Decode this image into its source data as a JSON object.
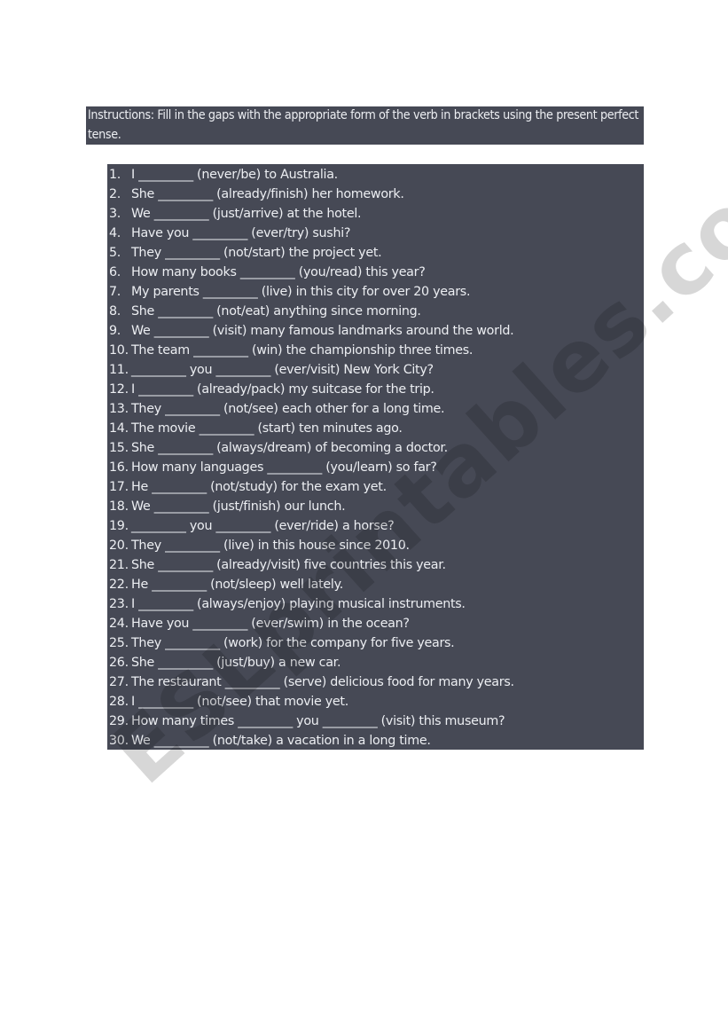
{
  "instructions": "Instructions: Fill in the gaps with the appropriate form of the verb in brackets using the present perfect tense.",
  "watermark": "ESLprintables.com",
  "colors": {
    "box_background": "#464955",
    "text": "#eceef2",
    "page_background": "#ffffff"
  },
  "exercises": [
    {
      "num": "1.",
      "text": "I _________ (never/be) to Australia."
    },
    {
      "num": "2.",
      "text": "She _________ (already/finish) her homework."
    },
    {
      "num": "3.",
      "text": "We _________ (just/arrive) at the hotel."
    },
    {
      "num": "4.",
      "text": "Have you _________ (ever/try) sushi?"
    },
    {
      "num": "5.",
      "text": "They _________ (not/start) the project yet."
    },
    {
      "num": "6.",
      "text": "How many books _________ (you/read) this year?"
    },
    {
      "num": "7.",
      "text": "My parents _________ (live) in this city for over 20 years."
    },
    {
      "num": "8.",
      "text": "She _________ (not/eat) anything since morning."
    },
    {
      "num": "9.",
      "text": "We _________ (visit) many famous landmarks around the world."
    },
    {
      "num": "10.",
      "text": "The team _________ (win) the championship three times."
    },
    {
      "num": "11.",
      "text": "_________ you _________ (ever/visit) New York City?"
    },
    {
      "num": "12.",
      "text": "I _________ (already/pack) my suitcase for the trip."
    },
    {
      "num": "13.",
      "text": "They _________ (not/see) each other for a long time."
    },
    {
      "num": "14.",
      "text": "The movie _________ (start) ten minutes ago."
    },
    {
      "num": "15.",
      "text": "She _________ (always/dream) of becoming a doctor."
    },
    {
      "num": "16.",
      "text": "How many languages _________ (you/learn) so far?"
    },
    {
      "num": "17.",
      "text": "He _________ (not/study) for the exam yet."
    },
    {
      "num": "18.",
      "text": "We _________ (just/finish) our lunch."
    },
    {
      "num": "19.",
      "text": "_________ you _________ (ever/ride) a horse?"
    },
    {
      "num": "20.",
      "text": "They _________ (live) in this house since 2010."
    },
    {
      "num": "21.",
      "text": "She _________ (already/visit) five countries this year."
    },
    {
      "num": "22.",
      "text": "He _________ (not/sleep) well lately."
    },
    {
      "num": "23.",
      "text": "I _________ (always/enjoy) playing musical instruments."
    },
    {
      "num": "24.",
      "text": "Have you _________ (ever/swim) in the ocean?"
    },
    {
      "num": "25.",
      "text": "They _________ (work) for the company for five years."
    },
    {
      "num": "26.",
      "text": "She _________ (just/buy) a new car."
    },
    {
      "num": "27.",
      "text": "The restaurant _________ (serve) delicious food for many years."
    },
    {
      "num": "28.",
      "text": "I _________ (not/see) that movie yet."
    },
    {
      "num": "29.",
      "text": "How many times _________ you _________ (visit) this museum?"
    },
    {
      "num": "30.",
      "text": "We _________ (not/take) a vacation in a long time."
    }
  ]
}
